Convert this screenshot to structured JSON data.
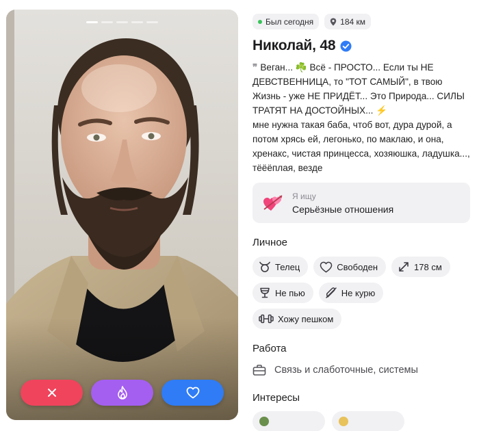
{
  "photo": {
    "pager": {
      "count": 5,
      "active_index": 0
    },
    "actions": {
      "dislike": "close-icon",
      "superlike": "flame-icon",
      "like": "heart-icon"
    },
    "colors": {
      "dislike": "#f0445d",
      "superlike": "#a45ff0",
      "like": "#2f7cf6"
    }
  },
  "status": {
    "online": "Был сегодня",
    "distance": "184 км",
    "online_color": "#39c35a"
  },
  "profile": {
    "name_age": "Николай, 48",
    "verified_color": "#2f7cf6",
    "bio": "Веган... ☘️ Всё - ПРОСТО... Если ты НЕ ДЕВСТВЕННИЦА, то \"ТОТ САМЫЙ\", в твою Жизнь - уже НЕ ПРИДЁТ... Это Природа... СИЛЫ ТРАТЯТ НА ДОСТОЙНЫХ... ⚡",
    "bio_2": "мне нужна такая баба, чтоб вот, дура дурой, а потом хрясь ей, легонько, по маклаю, и она, хренакс, чистая принцесса, хозяюшка, ладушка..., тёёёплая, везде"
  },
  "looking_for": {
    "label": "Я ищу",
    "value": "Серьёзные отношения",
    "icon": "hearts-arrow-icon"
  },
  "personal": {
    "title": "Личное",
    "items": [
      {
        "label": "Телец",
        "icon": "taurus-icon"
      },
      {
        "label": "Свободен",
        "icon": "heart-outline-icon"
      },
      {
        "label": "178 см",
        "icon": "height-arrows-icon"
      },
      {
        "label": "Не пью",
        "icon": "glass-icon"
      },
      {
        "label": "Не курю",
        "icon": "no-smoking-icon"
      },
      {
        "label": "Хожу пешком",
        "icon": "dumbbell-icon"
      }
    ]
  },
  "work": {
    "title": "Работа",
    "value": "Связь и слаботочные, системы",
    "icon": "briefcase-icon"
  },
  "interests": {
    "title": "Интересы"
  }
}
